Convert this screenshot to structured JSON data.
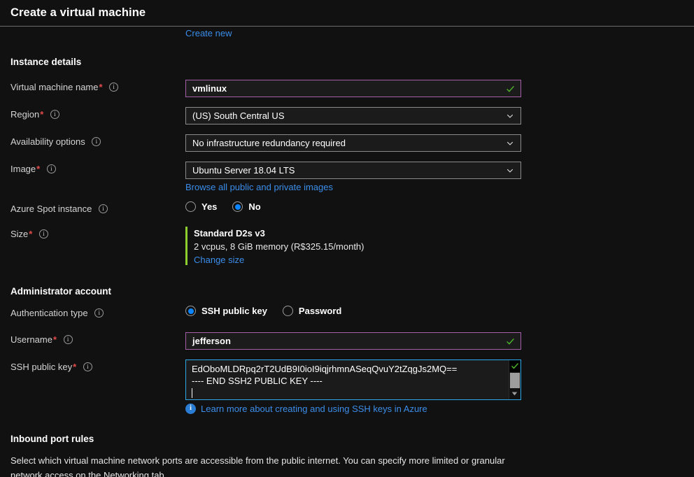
{
  "header": {
    "title": "Create a virtual machine"
  },
  "top": {
    "create_new_link": "Create new"
  },
  "instance_details": {
    "section_title": "Instance details",
    "vm_name": {
      "label": "Virtual machine name",
      "value": "vmlinux"
    },
    "region": {
      "label": "Region",
      "value": "(US) South Central US"
    },
    "availability": {
      "label": "Availability options",
      "value": "No infrastructure redundancy required"
    },
    "image": {
      "label": "Image",
      "value": "Ubuntu Server 18.04 LTS",
      "browse_link": "Browse all public and private images"
    },
    "spot": {
      "label": "Azure Spot instance",
      "option_yes": "Yes",
      "option_no": "No",
      "selected": "No"
    },
    "size": {
      "label": "Size",
      "name": "Standard D2s v3",
      "description": "2 vcpus, 8 GiB memory (R$325.15/month)",
      "change_link": "Change size"
    }
  },
  "administrator_account": {
    "section_title": "Administrator account",
    "auth_type": {
      "label": "Authentication type",
      "option_ssh": "SSH public key",
      "option_password": "Password",
      "selected": "SSH public key"
    },
    "username": {
      "label": "Username",
      "value": "jefferson"
    },
    "ssh_key": {
      "label": "SSH public key",
      "line1": "EdOboMLDRpq2rT2UdB9I0ioI9iqjrhmnASeqQvuY2tZqgJs2MQ==",
      "line2": "---- END SSH2 PUBLIC KEY ----",
      "note_link": "Learn more about creating and using SSH keys in Azure"
    }
  },
  "inbound_port_rules": {
    "section_title": "Inbound port rules",
    "description": "Select which virtual machine network ports are accessible from the public internet. You can specify more limited or granular network access on the Networking tab."
  },
  "colors": {
    "accent_link": "#3b8eea",
    "validated_border": "#a45ea8",
    "focus_border": "#2da8e8",
    "size_accent": "#8ecf2f",
    "radio_selected": "#0a84ff",
    "required_star": "#e34b4b"
  }
}
